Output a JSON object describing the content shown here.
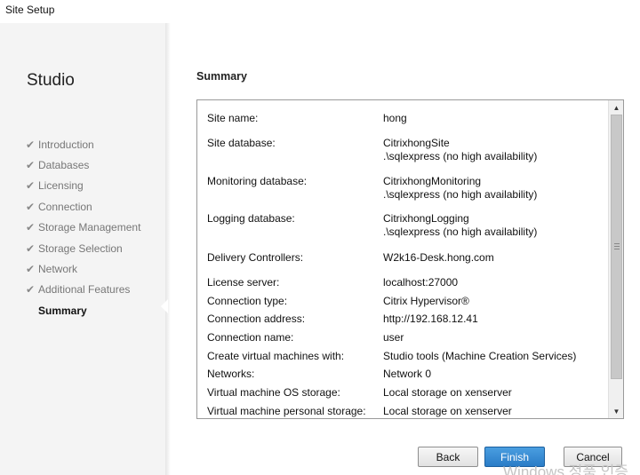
{
  "window": {
    "title": "Site Setup"
  },
  "sidebar": {
    "heading": "Studio",
    "items": [
      {
        "label": "Introduction",
        "done": true
      },
      {
        "label": "Databases",
        "done": true
      },
      {
        "label": "Licensing",
        "done": true
      },
      {
        "label": "Connection",
        "done": true
      },
      {
        "label": "Storage Management",
        "done": true
      },
      {
        "label": "Storage Selection",
        "done": true
      },
      {
        "label": "Network",
        "done": true
      },
      {
        "label": "Additional Features",
        "done": true
      },
      {
        "label": "Summary",
        "done": false,
        "active": true
      }
    ],
    "check_glyph": "✔"
  },
  "main": {
    "section_title": "Summary",
    "rows": [
      {
        "key": "Site name:",
        "value": "hong"
      },
      {
        "key": "Site database:",
        "value": "CitrixhongSite",
        "value2": ".\\sqlexpress (no high availability)"
      },
      {
        "key": "Monitoring database:",
        "value": "CitrixhongMonitoring",
        "value2": ".\\sqlexpress (no high availability)"
      },
      {
        "key": "Logging database:",
        "value": "CitrixhongLogging",
        "value2": ".\\sqlexpress (no high availability)"
      },
      {
        "key": "Delivery Controllers:",
        "value": "W2k16-Desk.hong.com"
      },
      {
        "key": "License server:",
        "value": "localhost:27000"
      },
      {
        "key": "Connection type:",
        "value": "Citrix Hypervisor®"
      },
      {
        "key": "Connection address:",
        "value": "http://192.168.12.41"
      },
      {
        "key": "Connection name:",
        "value": "user"
      },
      {
        "key": "Create virtual machines with:",
        "value": "Studio tools (Machine Creation Services)"
      },
      {
        "key": "Networks:",
        "value": "Network 0"
      },
      {
        "key": "Virtual machine OS storage:",
        "value": "Local storage on xenserver"
      },
      {
        "key": "Virtual machine personal storage:",
        "value": "Local storage on xenserver"
      }
    ]
  },
  "buttons": {
    "back": "Back",
    "finish": "Finish",
    "cancel": "Cancel"
  },
  "watermark": "Windows 정품 인증",
  "colors": {
    "finish_button": "#2a7cc7",
    "sidebar_bg": "#f4f4f4",
    "text_muted": "#777777"
  }
}
